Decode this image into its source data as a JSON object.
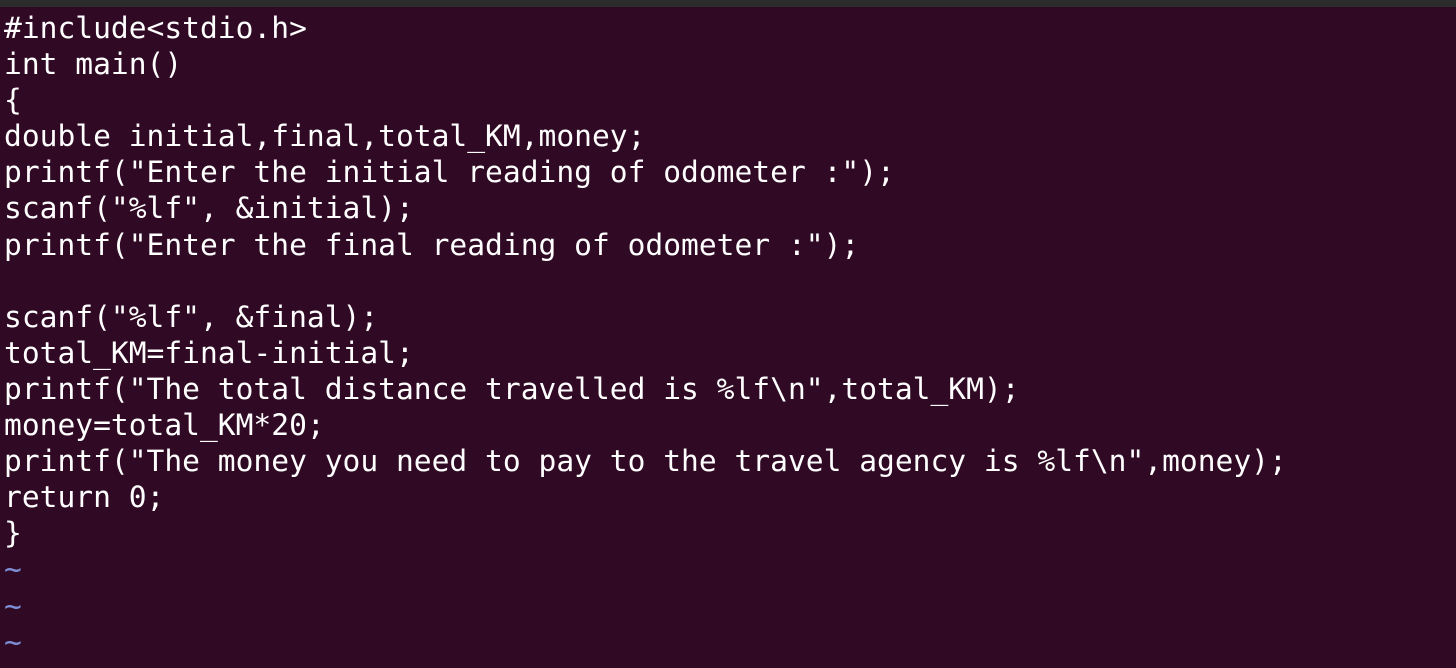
{
  "editor": {
    "colors": {
      "background": "#300a24",
      "text": "#ffffff",
      "tilde": "#7e8fd6"
    },
    "lines": [
      "#include<stdio.h>",
      "int main()",
      "{",
      "double initial,final,total_KM,money;",
      "printf(\"Enter the initial reading of odometer :\");",
      "scanf(\"%lf\", &initial);",
      "printf(\"Enter the final reading of odometer :\");",
      "",
      "scanf(\"%lf\", &final);",
      "total_KM=final-initial;",
      "printf(\"The total distance travelled is %lf\\n\",total_KM);",
      "money=total_KM*20;",
      "printf(\"The money you need to pay to the travel agency is %lf\\n\",money);",
      "return 0;",
      "}"
    ],
    "tildes": [
      "~",
      "~",
      "~"
    ]
  }
}
